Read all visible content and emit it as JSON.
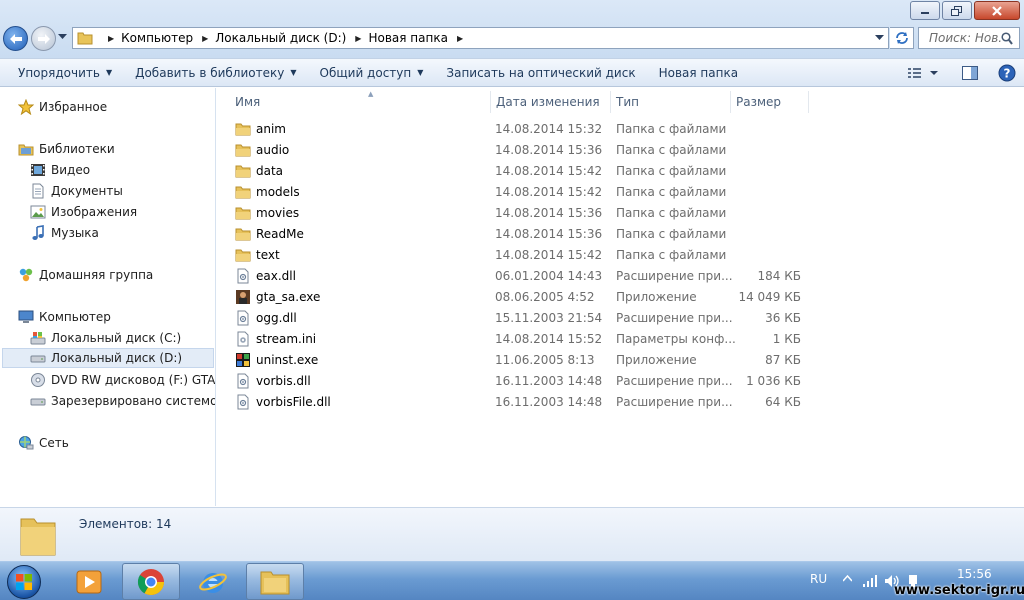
{
  "address": {
    "crumbs": [
      "Компьютер",
      "Локальный диск (D:)",
      "Новая папка"
    ]
  },
  "search": {
    "placeholder": "Поиск: Нов..."
  },
  "toolbar": {
    "organize": "Упорядочить",
    "add_library": "Добавить в библиотеку",
    "share": "Общий доступ",
    "burn": "Записать на оптический диск",
    "new_folder": "Новая папка"
  },
  "nav": {
    "favorites": "Избранное",
    "libraries": "Библиотеки",
    "video": "Видео",
    "documents": "Документы",
    "images": "Изображения",
    "music": "Музыка",
    "homegroup": "Домашняя группа",
    "computer": "Компьютер",
    "disk_c": "Локальный диск (C:)",
    "disk_d": "Локальный диск (D:)",
    "dvd": "DVD RW дисковод (F:) GTADISK",
    "reserved": "Зарезервировано системой (G:)",
    "network": "Сеть"
  },
  "columns": {
    "name": "Имя",
    "date": "Дата изменения",
    "type": "Тип",
    "size": "Размер"
  },
  "files": [
    {
      "name": "anim",
      "date": "14.08.2014 15:32",
      "type": "Папка с файлами",
      "size": "",
      "icon": "folder-icon"
    },
    {
      "name": "audio",
      "date": "14.08.2014 15:36",
      "type": "Папка с файлами",
      "size": "",
      "icon": "folder-icon"
    },
    {
      "name": "data",
      "date": "14.08.2014 15:42",
      "type": "Папка с файлами",
      "size": "",
      "icon": "folder-icon"
    },
    {
      "name": "models",
      "date": "14.08.2014 15:42",
      "type": "Папка с файлами",
      "size": "",
      "icon": "folder-icon"
    },
    {
      "name": "movies",
      "date": "14.08.2014 15:36",
      "type": "Папка с файлами",
      "size": "",
      "icon": "folder-icon"
    },
    {
      "name": "ReadMe",
      "date": "14.08.2014 15:36",
      "type": "Папка с файлами",
      "size": "",
      "icon": "folder-icon"
    },
    {
      "name": "text",
      "date": "14.08.2014 15:42",
      "type": "Папка с файлами",
      "size": "",
      "icon": "folder-icon"
    },
    {
      "name": "eax.dll",
      "date": "06.01.2004 14:43",
      "type": "Расширение при...",
      "size": "184 КБ",
      "icon": "dll-file-icon"
    },
    {
      "name": "gta_sa.exe",
      "date": "08.06.2005 4:52",
      "type": "Приложение",
      "size": "14 049 КБ",
      "icon": "game-exe-icon"
    },
    {
      "name": "ogg.dll",
      "date": "15.11.2003 21:54",
      "type": "Расширение при...",
      "size": "36 КБ",
      "icon": "dll-file-icon"
    },
    {
      "name": "stream.ini",
      "date": "14.08.2014 15:52",
      "type": "Параметры конф...",
      "size": "1 КБ",
      "icon": "ini-file-icon"
    },
    {
      "name": "uninst.exe",
      "date": "11.06.2005 8:13",
      "type": "Приложение",
      "size": "87 КБ",
      "icon": "uninstall-exe-icon"
    },
    {
      "name": "vorbis.dll",
      "date": "16.11.2003 14:48",
      "type": "Расширение при...",
      "size": "1 036 КБ",
      "icon": "dll-file-icon"
    },
    {
      "name": "vorbisFile.dll",
      "date": "16.11.2003 14:48",
      "type": "Расширение при...",
      "size": "64 КБ",
      "icon": "dll-file-icon"
    }
  ],
  "details": {
    "count": "Элементов: 14"
  },
  "taskbar": {
    "lang": "RU",
    "time": "15:56",
    "watermark": "www.sektor-igr.ru"
  }
}
